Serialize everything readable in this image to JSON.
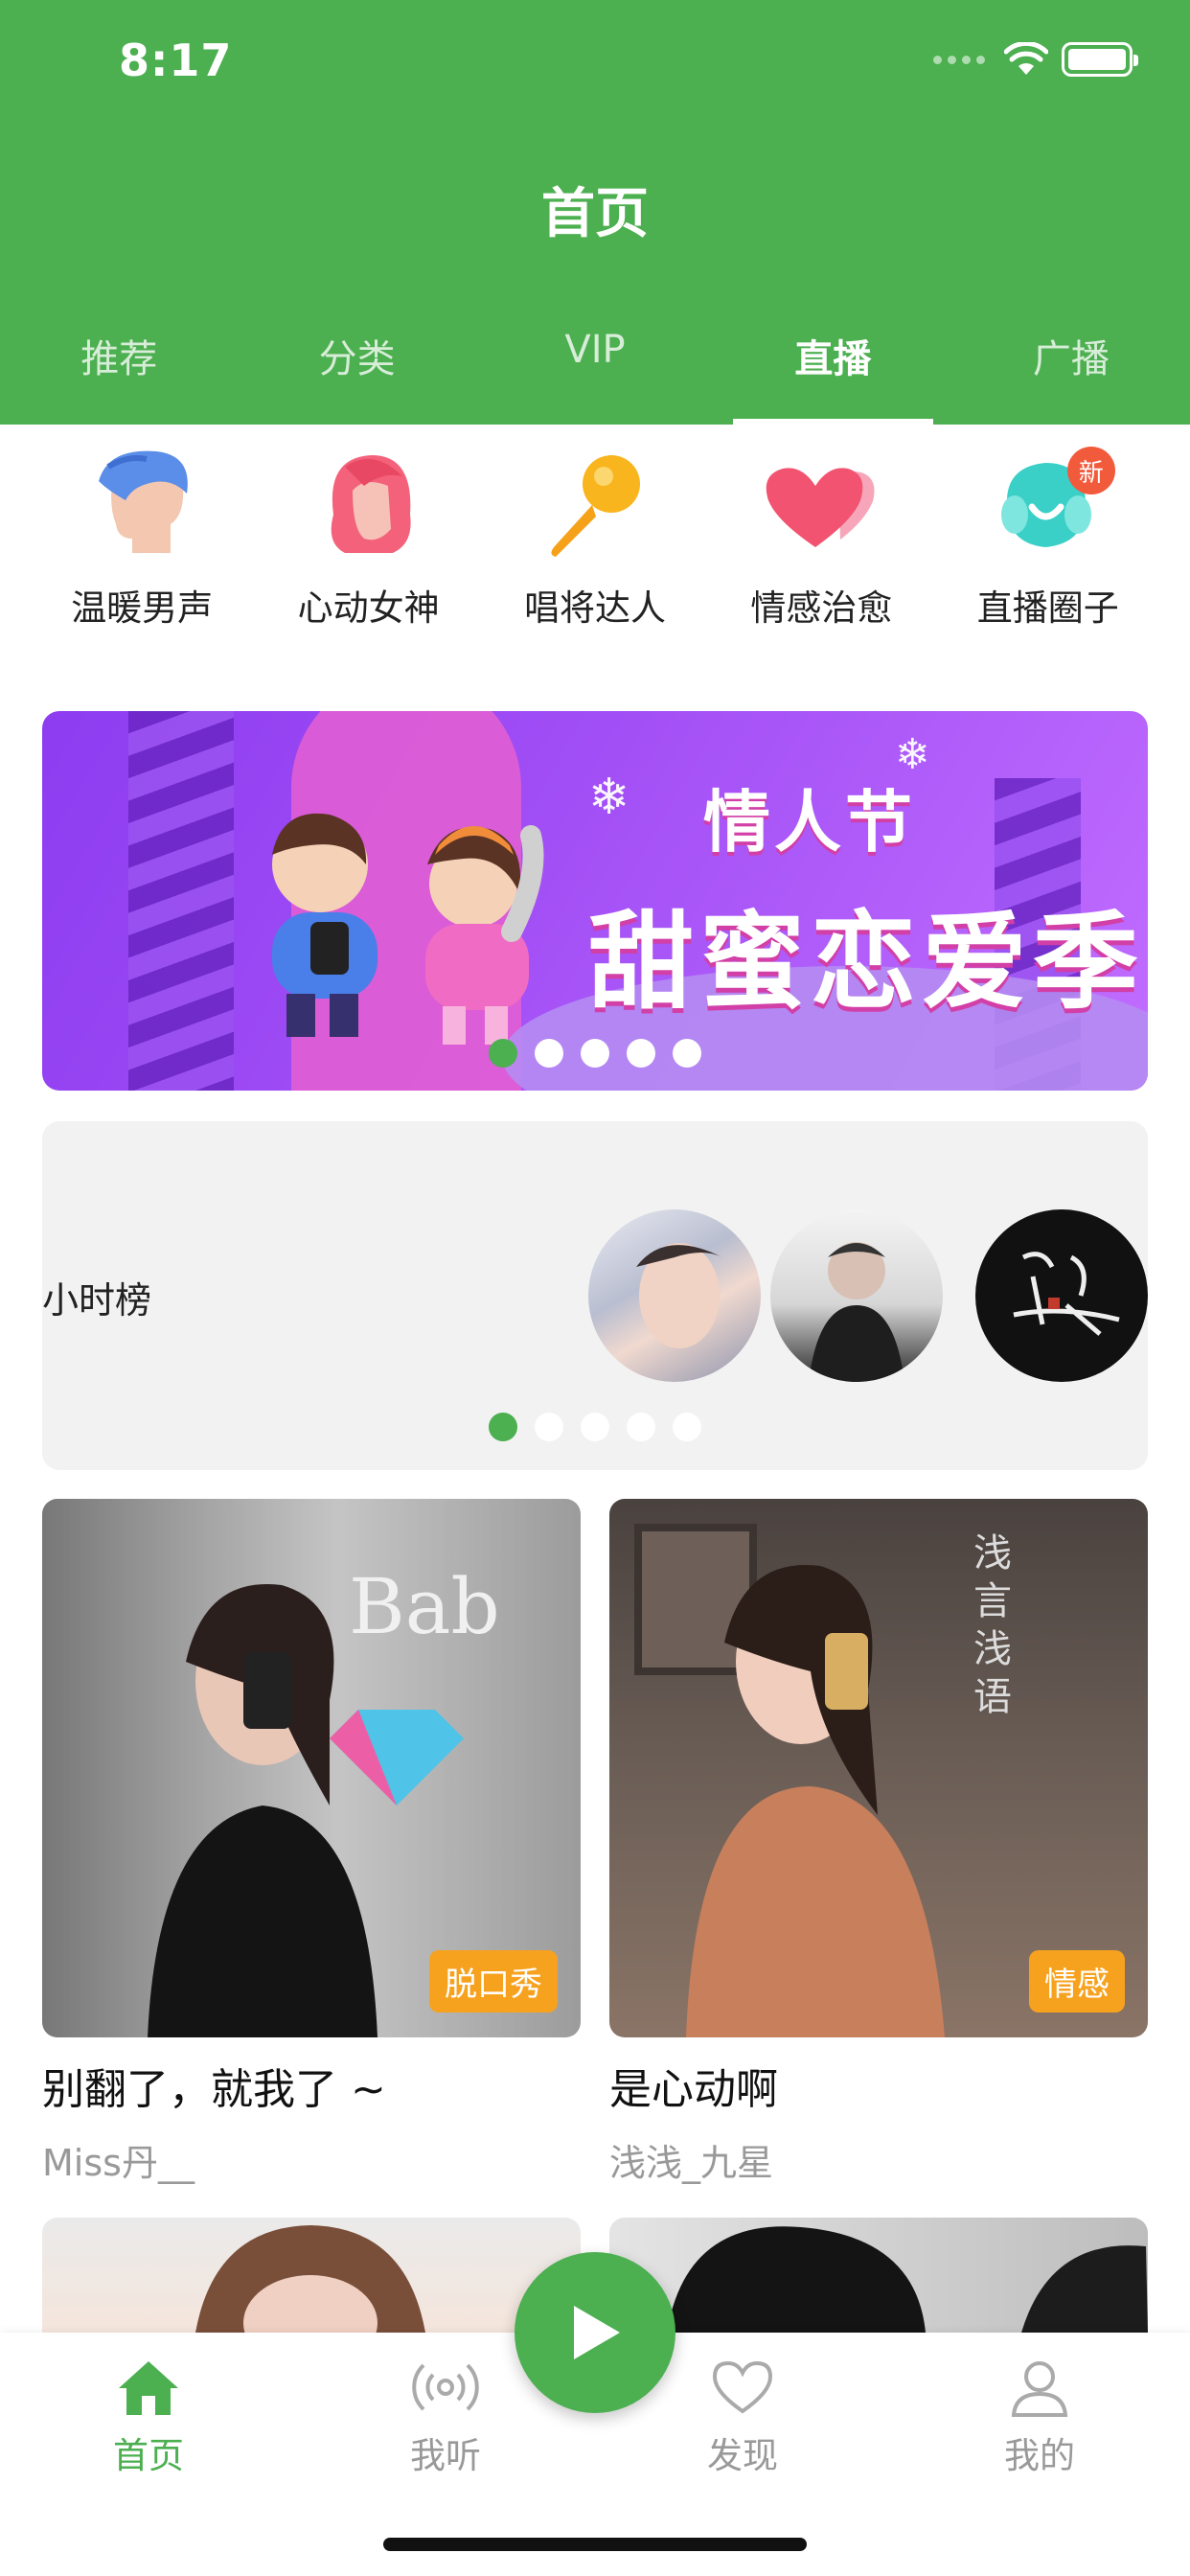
{
  "status_bar": {
    "time": "8:17"
  },
  "header": {
    "title": "首页"
  },
  "tabs": [
    {
      "label": "推荐",
      "active": false
    },
    {
      "label": "分类",
      "active": false
    },
    {
      "label": "VIP",
      "active": false
    },
    {
      "label": "直播",
      "active": true
    },
    {
      "label": "广播",
      "active": false
    }
  ],
  "categories": [
    {
      "label": "温暖男声",
      "icon": "boy-head-icon"
    },
    {
      "label": "心动女神",
      "icon": "girl-head-icon"
    },
    {
      "label": "唱将达人",
      "icon": "microphone-icon"
    },
    {
      "label": "情感治愈",
      "icon": "hearts-icon"
    },
    {
      "label": "直播圈子",
      "icon": "circle-smile-icon",
      "badge": "新"
    }
  ],
  "banner": {
    "title_small": "情人节",
    "title_big": "甜蜜恋爱季",
    "page_count": 5,
    "active_page": 1
  },
  "hour_rank": {
    "label": "小时榜",
    "page_count": 5,
    "active_page": 1
  },
  "live_cards": [
    {
      "title": "别翻了，就我了 ~",
      "author": "Miss丹__",
      "tag": "脱口秀"
    },
    {
      "title": " 是心动啊",
      "author": "浅浅_九星",
      "tag": "情感"
    }
  ],
  "bottom_nav": [
    {
      "label": "首页",
      "icon": "home-icon",
      "active": true
    },
    {
      "label": "我听",
      "icon": "radio-waves-icon",
      "active": false
    },
    {
      "label": "发现",
      "icon": "heart-outline-icon",
      "active": false
    },
    {
      "label": "我的",
      "icon": "person-icon",
      "active": false
    }
  ],
  "colors": {
    "primary": "#4caf50",
    "tag_orange": "#f7a21e",
    "badge_red": "#f25a3c"
  }
}
